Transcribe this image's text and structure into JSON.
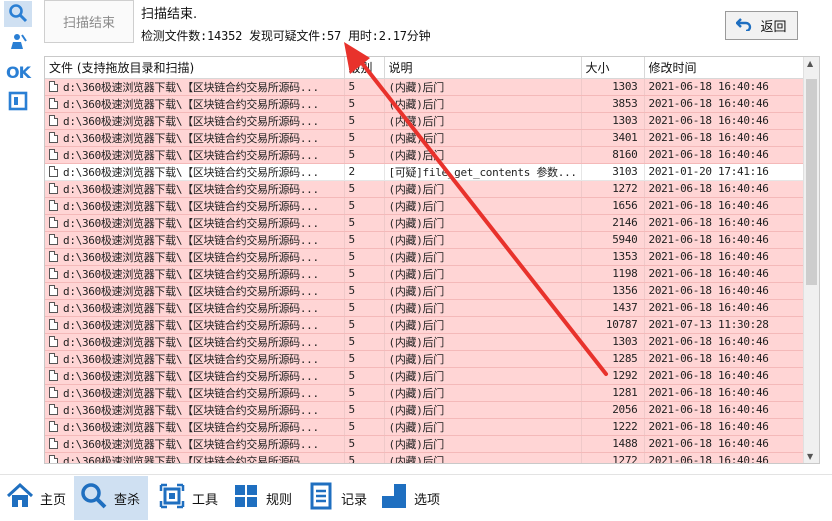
{
  "header": {
    "scan_stop_label": "扫描结束",
    "status_title": "扫描结束.",
    "status_detail": "检测文件数:14352 发现可疑文件:57 用时:2.17分钟",
    "back_label": "返回"
  },
  "left_rail": {
    "items": [
      {
        "icon": "search-icon"
      },
      {
        "icon": "user-clean-icon"
      },
      {
        "label": "OK"
      },
      {
        "icon": "frame-icon"
      }
    ]
  },
  "table": {
    "columns": [
      "文件 (支持拖放目录和扫描)",
      "级别",
      "说明",
      "大小",
      "修改时间"
    ],
    "rows": [
      {
        "file": "d:\\360极速浏览器下载\\【区块链合约交易所源码...",
        "level": "5",
        "desc": "(内藏)后门",
        "size": "1303",
        "mtime": "2021-06-18 16:40:46",
        "suspicious": true
      },
      {
        "file": "d:\\360极速浏览器下载\\【区块链合约交易所源码...",
        "level": "5",
        "desc": "(内藏)后门",
        "size": "3853",
        "mtime": "2021-06-18 16:40:46",
        "suspicious": true
      },
      {
        "file": "d:\\360极速浏览器下载\\【区块链合约交易所源码...",
        "level": "5",
        "desc": "(内藏)后门",
        "size": "1303",
        "mtime": "2021-06-18 16:40:46",
        "suspicious": true
      },
      {
        "file": "d:\\360极速浏览器下载\\【区块链合约交易所源码...",
        "level": "5",
        "desc": "(内藏)后门",
        "size": "3401",
        "mtime": "2021-06-18 16:40:46",
        "suspicious": true
      },
      {
        "file": "d:\\360极速浏览器下载\\【区块链合约交易所源码...",
        "level": "5",
        "desc": "(内藏)后门",
        "size": "8160",
        "mtime": "2021-06-18 16:40:46",
        "suspicious": true
      },
      {
        "file": "d:\\360极速浏览器下载\\【区块链合约交易所源码...",
        "level": "2",
        "desc": "[可疑]file_get_contents 参数...",
        "size": "3103",
        "mtime": "2021-01-20 17:41:16",
        "suspicious": false
      },
      {
        "file": "d:\\360极速浏览器下载\\【区块链合约交易所源码...",
        "level": "5",
        "desc": "(内藏)后门",
        "size": "1272",
        "mtime": "2021-06-18 16:40:46",
        "suspicious": true
      },
      {
        "file": "d:\\360极速浏览器下载\\【区块链合约交易所源码...",
        "level": "5",
        "desc": "(内藏)后门",
        "size": "1656",
        "mtime": "2021-06-18 16:40:46",
        "suspicious": true
      },
      {
        "file": "d:\\360极速浏览器下载\\【区块链合约交易所源码...",
        "level": "5",
        "desc": "(内藏)后门",
        "size": "2146",
        "mtime": "2021-06-18 16:40:46",
        "suspicious": true
      },
      {
        "file": "d:\\360极速浏览器下载\\【区块链合约交易所源码...",
        "level": "5",
        "desc": "(内藏)后门",
        "size": "5940",
        "mtime": "2021-06-18 16:40:46",
        "suspicious": true
      },
      {
        "file": "d:\\360极速浏览器下载\\【区块链合约交易所源码...",
        "level": "5",
        "desc": "(内藏)后门",
        "size": "1353",
        "mtime": "2021-06-18 16:40:46",
        "suspicious": true
      },
      {
        "file": "d:\\360极速浏览器下载\\【区块链合约交易所源码...",
        "level": "5",
        "desc": "(内藏)后门",
        "size": "1198",
        "mtime": "2021-06-18 16:40:46",
        "suspicious": true
      },
      {
        "file": "d:\\360极速浏览器下载\\【区块链合约交易所源码...",
        "level": "5",
        "desc": "(内藏)后门",
        "size": "1356",
        "mtime": "2021-06-18 16:40:46",
        "suspicious": true
      },
      {
        "file": "d:\\360极速浏览器下载\\【区块链合约交易所源码...",
        "level": "5",
        "desc": "(内藏)后门",
        "size": "1437",
        "mtime": "2021-06-18 16:40:46",
        "suspicious": true
      },
      {
        "file": "d:\\360极速浏览器下载\\【区块链合约交易所源码...",
        "level": "5",
        "desc": "(内藏)后门",
        "size": "10787",
        "mtime": "2021-07-13 11:30:28",
        "suspicious": true
      },
      {
        "file": "d:\\360极速浏览器下载\\【区块链合约交易所源码...",
        "level": "5",
        "desc": "(内藏)后门",
        "size": "1303",
        "mtime": "2021-06-18 16:40:46",
        "suspicious": true
      },
      {
        "file": "d:\\360极速浏览器下载\\【区块链合约交易所源码...",
        "level": "5",
        "desc": "(内藏)后门",
        "size": "1285",
        "mtime": "2021-06-18 16:40:46",
        "suspicious": true
      },
      {
        "file": "d:\\360极速浏览器下载\\【区块链合约交易所源码...",
        "level": "5",
        "desc": "(内藏)后门",
        "size": "1292",
        "mtime": "2021-06-18 16:40:46",
        "suspicious": true
      },
      {
        "file": "d:\\360极速浏览器下载\\【区块链合约交易所源码...",
        "level": "5",
        "desc": "(内藏)后门",
        "size": "1281",
        "mtime": "2021-06-18 16:40:46",
        "suspicious": true
      },
      {
        "file": "d:\\360极速浏览器下载\\【区块链合约交易所源码...",
        "level": "5",
        "desc": "(内藏)后门",
        "size": "2056",
        "mtime": "2021-06-18 16:40:46",
        "suspicious": true
      },
      {
        "file": "d:\\360极速浏览器下载\\【区块链合约交易所源码...",
        "level": "5",
        "desc": "(内藏)后门",
        "size": "1222",
        "mtime": "2021-06-18 16:40:46",
        "suspicious": true
      },
      {
        "file": "d:\\360极速浏览器下载\\【区块链合约交易所源码...",
        "level": "5",
        "desc": "(内藏)后门",
        "size": "1488",
        "mtime": "2021-06-18 16:40:46",
        "suspicious": true
      },
      {
        "file": "d:\\360极速浏览器下载\\【区块链合约交易所源码...",
        "level": "5",
        "desc": "(内藏)后门",
        "size": "1272",
        "mtime": "2021-06-18 16:40:46",
        "suspicious": true
      }
    ]
  },
  "bottom_nav": {
    "items": [
      {
        "label": "主页",
        "icon": "home-icon",
        "active": false
      },
      {
        "label": "查杀",
        "icon": "search-icon",
        "active": true
      },
      {
        "label": "工具",
        "icon": "tools-icon",
        "active": false
      },
      {
        "label": "规则",
        "icon": "grid-icon",
        "active": false
      },
      {
        "label": "记录",
        "icon": "log-icon",
        "active": false
      },
      {
        "label": "选项",
        "icon": "options-icon",
        "active": false
      }
    ]
  },
  "colors": {
    "accent": "#2a7fd4",
    "suspicious_row": "#ffd5d5",
    "annotation_arrow": "#e8322c",
    "active_nav": "#cfe0f2"
  }
}
